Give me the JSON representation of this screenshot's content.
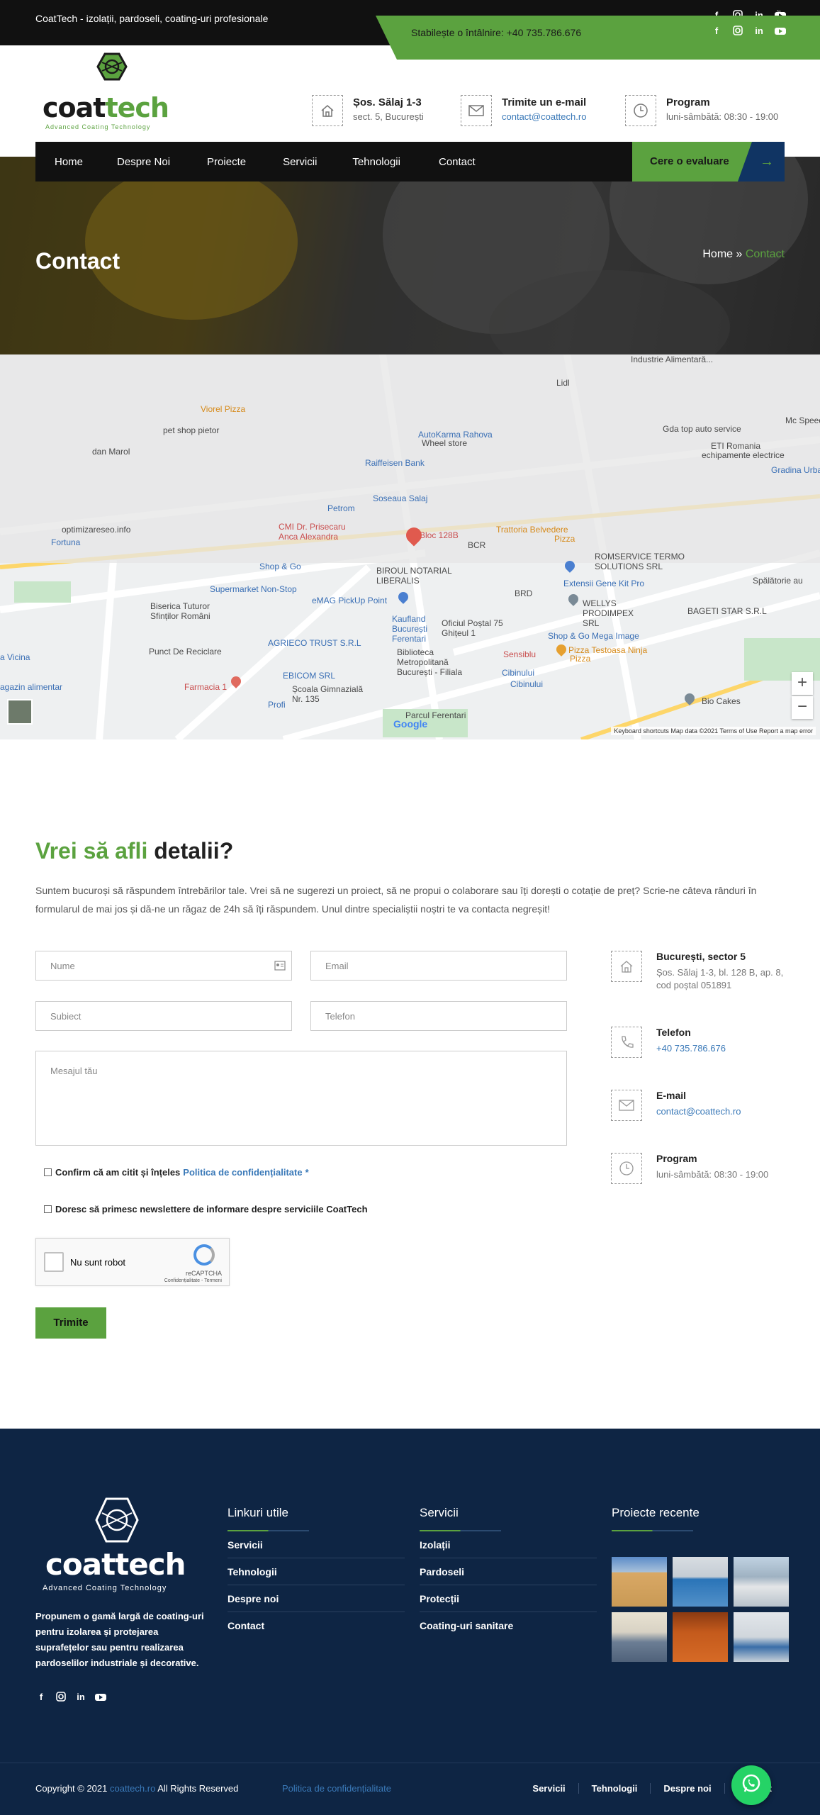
{
  "topbar": {
    "tagline": "CoatTech - izolații, pardoseli, coating-uri profesionale",
    "phone": "Stabilește o întâlnire: +40 735.786.676",
    "social": [
      "facebook-icon",
      "instagram-icon",
      "linkedin-icon",
      "youtube-icon"
    ]
  },
  "logo": {
    "text": "coattech",
    "subtitle": "Advanced Coating Technology"
  },
  "header_info": [
    {
      "icon": "home-icon",
      "title": "Șos. Sălaj 1-3",
      "sub": "sect. 5, București"
    },
    {
      "icon": "envelope-icon",
      "title": "Trimite un e-mail",
      "sub": "contact@coattech.ro"
    },
    {
      "icon": "clock-icon",
      "title": "Program",
      "sub": "luni-sâmbătă: 08:30 - 19:00"
    }
  ],
  "nav": {
    "items": [
      "Home",
      "Despre Noi",
      "Proiecte",
      "Servicii",
      "Tehnologii",
      "Contact"
    ],
    "cta": "Cere o evaluare",
    "cta_arrow": "→"
  },
  "hero": {
    "title": "Contact",
    "breadcrumb_home": "Home",
    "breadcrumb_sep": "»",
    "breadcrumb_current": "Contact"
  },
  "map": {
    "labels": {
      "industrie": "Industrie Alimentară...",
      "lidl": "Lidl",
      "viorelpizza": "Viorel Pizza",
      "petshop": "pet shop pietor",
      "danmarol": "dan Marol",
      "autokarma": "AutoKarma Rahova",
      "wheelstore": "Wheel store",
      "gdatop": "Gda top auto service",
      "mcspeed": "Mc Speed Service A",
      "etiromania": "ETI Romania",
      "echipamente": "echipamente electrice",
      "raiffeisen": "Raiffeisen Bank",
      "gradina": "Gradina Urba Concept SR",
      "soseasalaj": "Soseaua Salaj",
      "petrom": "Petrom",
      "optimizare": "optimizareseo.info",
      "cmi": "CMI Dr. Prisecaru Anca Alexandra",
      "bloc128": "Bloc 128B",
      "trattoria": "Trattoria Belvedere",
      "trattoria_pizza": "Pizza",
      "fortuna": "Fortuna",
      "bcr": "BCR",
      "romservice": "ROMSERVICE TERMO SOLUTIONS SRL",
      "shopgo": "Shop & Go",
      "birou": "BIROUL NOTARIAL LIBERALIS",
      "extensii": "Extensii Gene Kit Pro",
      "brd": "BRD",
      "supermarket": "Supermarket Non-Stop",
      "emag": "eMAG PickUp Point",
      "wellys": "WELLYS PRODIMPEX SRL",
      "bagetistar": "BAGETI STAR S.R.L",
      "spalatorie": "Spălătorie au",
      "biserica": "Biserica Tuturor Sfinților Români",
      "kaufland": "Kaufland București Ferentari",
      "oficiul": "Oficiul Poștal 75 Ghițeul 1",
      "shopgomega": "Shop & Go Mega Image",
      "vicina": "a Vicina",
      "punct": "Punct De Reciclare",
      "agrieco": "AGRIECO TRUST S.R.L",
      "biblioteca": "Biblioteca Metropolitană București - Filiala",
      "sensiblu": "Sensiblu",
      "testoasa": "Pizza Testoasa Ninja",
      "testoasa_pizza": "Pizza",
      "cibinului1": "Cibinului",
      "cibinului2": "Cibinului",
      "ebicom": "EBICOM SRL",
      "farmacia": "Farmacia 1",
      "profi": "Profi",
      "scoala": "Școala Gimnazială Nr. 135",
      "parcul": "Parcul Ferentari",
      "biocakes": "Bio Cakes",
      "magazin": "agazin alimentar",
      "google": "Google",
      "zoom_in": "+",
      "zoom_out": "−"
    },
    "attribution": "Keyboard shortcuts   Map data ©2021   Terms of Use   Report a map error"
  },
  "contact": {
    "title_green": "Vrei să afli",
    "title_dark": "detalii?",
    "description": "Suntem bucuroși să răspundem întrebărilor tale. Vrei să ne sugerezi un proiect, să ne propui o colaborare sau îți dorești o cotație de preț? Scrie-ne câteva rânduri în formularul de mai jos și dă-ne un răgaz de 24h să îți răspundem. Unul dintre specialiștii noștri te va contacta negreșit!",
    "fields": {
      "name": "Nume",
      "email": "Email",
      "subject": "Subiect",
      "phone": "Telefon",
      "message": "Mesajul tău"
    },
    "consent_text": "Confirm că am citit și înțeles",
    "consent_link": "Politica de confidențialitate",
    "consent_req": "*",
    "newsletter_text": "Doresc să primesc newslettere de informare despre serviciile CoatTech",
    "captcha_label": "Nu sunt robot",
    "captcha_brand": "reCAPTCHA",
    "captcha_links": "Confidențialitate - Termeni",
    "submit": "Trimite",
    "info": [
      {
        "icon": "home-icon",
        "title": "București, sector 5",
        "text": "Șos. Sălaj 1-3, bl. 128 B, ap. 8, cod poștal 051891"
      },
      {
        "icon": "phone-icon",
        "title": "Telefon",
        "text": "+40 735.786.676"
      },
      {
        "icon": "envelope-icon",
        "title": "E-mail",
        "text": "contact@coattech.ro"
      },
      {
        "icon": "clock-icon",
        "title": "Program",
        "text": "luni-sâmbătă: 08:30 - 19:00"
      }
    ]
  },
  "footer": {
    "about": "Propunem o gamă largă de coating-uri pentru izolarea și protejarea suprafețelor sau pentru realizarea pardoselilor industriale și decorative.",
    "useful_title": "Linkuri utile",
    "useful_links": [
      "Servicii",
      "Tehnologii",
      "Despre noi",
      "Contact"
    ],
    "services_title": "Servicii",
    "services_links": [
      "Izolații",
      "Pardoseli",
      "Protecții",
      "Coating-uri sanitare"
    ],
    "projects_title": "Proiecte recente",
    "copyright": "Copyright © 2021",
    "copyright_link": "coattech.ro",
    "copyright_rest": "All Rights Reserved",
    "policy": "Politica de confidențialitate",
    "bottom_links": [
      "Servicii",
      "Tehnologii",
      "Despre noi",
      "Contact"
    ]
  },
  "colors": {
    "accent": "#5ba23f",
    "navy": "#0e2544",
    "link": "#3a79b8"
  }
}
